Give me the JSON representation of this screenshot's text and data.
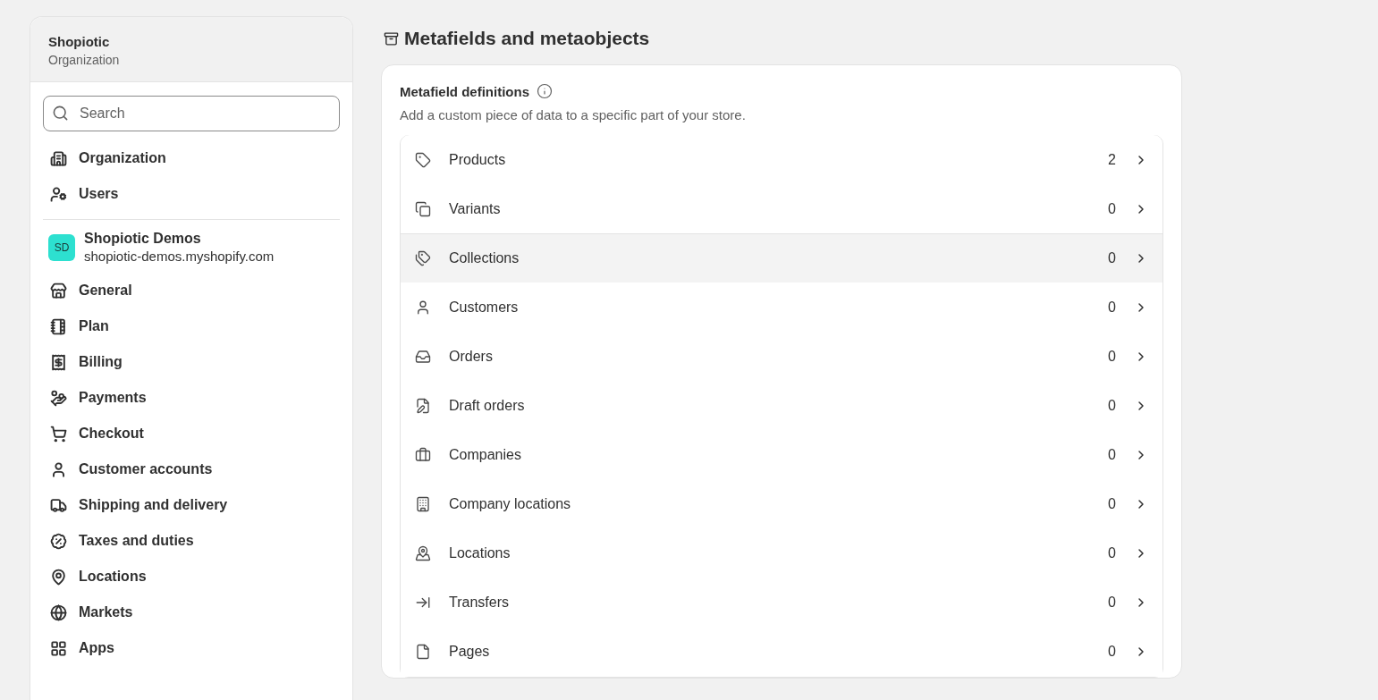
{
  "sidebar": {
    "org_name": "Shopiotic",
    "org_subtitle": "Organization",
    "search": {
      "placeholder": "Search"
    },
    "org_items": [
      {
        "label": "Organization"
      },
      {
        "label": "Users"
      }
    ],
    "store": {
      "avatar": "SD",
      "color": "#2de0d0",
      "name": "Shopiotic Demos",
      "domain": "shopiotic-demos.myshopify.com"
    },
    "store_items": [
      {
        "label": "General"
      },
      {
        "label": "Plan"
      },
      {
        "label": "Billing"
      },
      {
        "label": "Payments"
      },
      {
        "label": "Checkout"
      },
      {
        "label": "Customer accounts"
      },
      {
        "label": "Shipping and delivery"
      },
      {
        "label": "Taxes and duties"
      },
      {
        "label": "Locations"
      },
      {
        "label": "Markets"
      },
      {
        "label": "Apps"
      }
    ]
  },
  "page": {
    "title": "Metafields and metaobjects",
    "card": {
      "title": "Metafield definitions",
      "description": "Add a custom piece of data to a specific part of your store.",
      "rows": [
        {
          "label": "Products",
          "count": "2",
          "selected": false
        },
        {
          "label": "Variants",
          "count": "0",
          "selected": false
        },
        {
          "label": "Collections",
          "count": "0",
          "selected": true
        },
        {
          "label": "Customers",
          "count": "0",
          "selected": false
        },
        {
          "label": "Orders",
          "count": "0",
          "selected": false
        },
        {
          "label": "Draft orders",
          "count": "0",
          "selected": false
        },
        {
          "label": "Companies",
          "count": "0",
          "selected": false
        },
        {
          "label": "Company locations",
          "count": "0",
          "selected": false
        },
        {
          "label": "Locations",
          "count": "0",
          "selected": false
        },
        {
          "label": "Transfers",
          "count": "0",
          "selected": false
        },
        {
          "label": "Pages",
          "count": "0",
          "selected": false
        }
      ]
    }
  }
}
